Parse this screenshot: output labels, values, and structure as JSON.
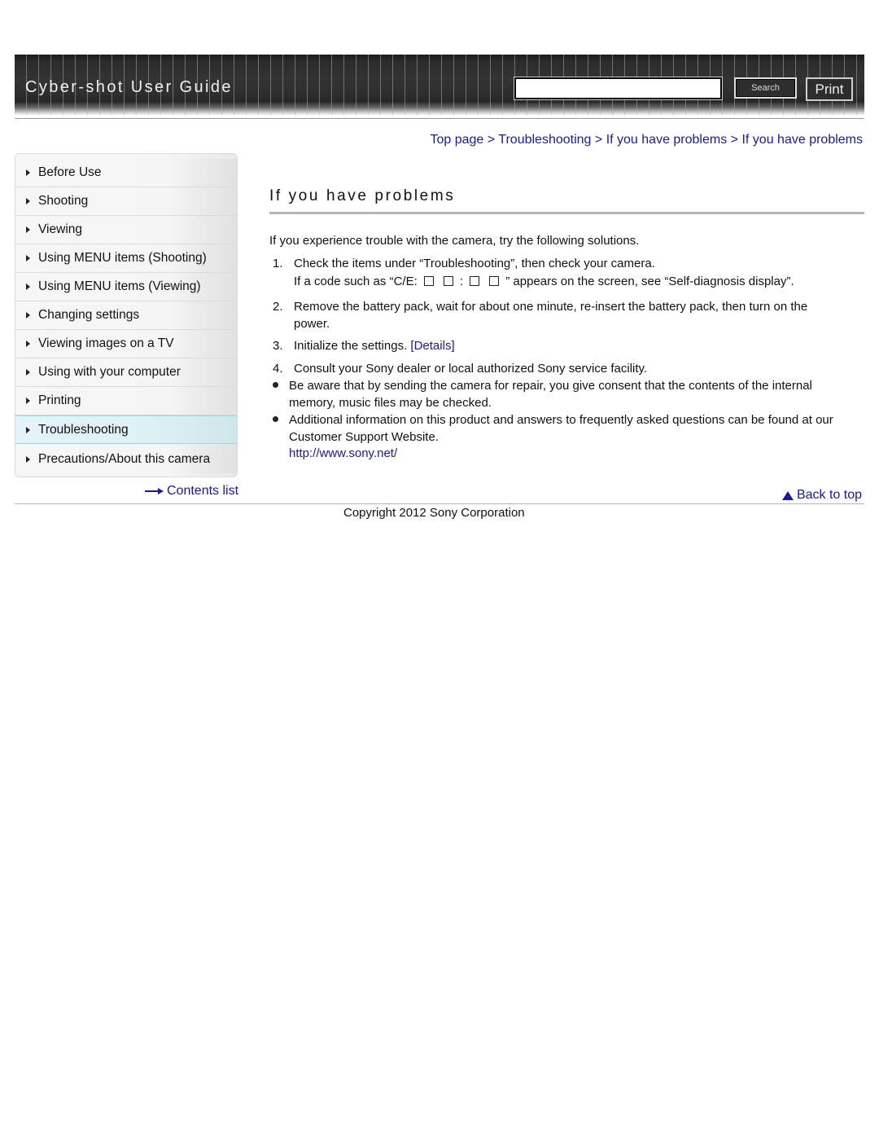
{
  "header": {
    "title": "Cyber-shot User Guide",
    "search_placeholder": "",
    "search_value": "",
    "search_label": "Search",
    "print_label": "Print"
  },
  "breadcrumb": {
    "items": [
      "Top page",
      "Troubleshooting",
      "If you have problems",
      "If you have problems"
    ],
    "separator": ">"
  },
  "sidebar": {
    "items": [
      {
        "label": "Before Use",
        "active": false
      },
      {
        "label": "Shooting",
        "active": false
      },
      {
        "label": "Viewing",
        "active": false
      },
      {
        "label": "Using MENU items (Shooting)",
        "active": false
      },
      {
        "label": "Using MENU items (Viewing)",
        "active": false
      },
      {
        "label": "Changing settings",
        "active": false
      },
      {
        "label": "Viewing images on a TV",
        "active": false
      },
      {
        "label": "Using with your computer",
        "active": false
      },
      {
        "label": "Printing",
        "active": false
      },
      {
        "label": "Troubleshooting",
        "active": true
      },
      {
        "label": "Precautions/About this camera",
        "active": false
      }
    ],
    "contents_link": "Contents list"
  },
  "main": {
    "title": "If you have problems",
    "intro": "If you experience trouble with the camera, try the following solutions.",
    "steps": [
      {
        "num": "1.",
        "text": "Check the items under “Troubleshooting”, then check your camera.",
        "sub_prefix": "If a code such as “C/E:",
        "sub_colon": ":",
        "sub_suffix": "” appears on the screen, see “Self-diagnosis display”."
      },
      {
        "num": "2.",
        "text_line1": "Remove the battery pack, wait for about one minute, re-insert the battery pack, then turn on the",
        "text_line2": "power."
      },
      {
        "num": "3.",
        "text": "Initialize the settings.",
        "link": "[Details]"
      },
      {
        "num": "4.",
        "text": "Consult your Sony dealer or local authorized Sony service facility."
      }
    ],
    "notes": [
      {
        "line1": "Be aware that by sending the camera for repair, you give consent that the contents of the internal",
        "line2": "memory, music files may be checked."
      },
      {
        "line1": "Additional information on this product and answers to frequently asked questions can be found at our",
        "line2": "Customer Support Website.",
        "link": "http://www.sony.net/"
      }
    ],
    "back_to_top": "Back to top"
  },
  "footer": {
    "copyright": "Copyright 2012 Sony Corporation"
  },
  "colors": {
    "link": "#1a1a99",
    "header_bg": "#2d2d2d",
    "active_nav": "#def1f5"
  }
}
